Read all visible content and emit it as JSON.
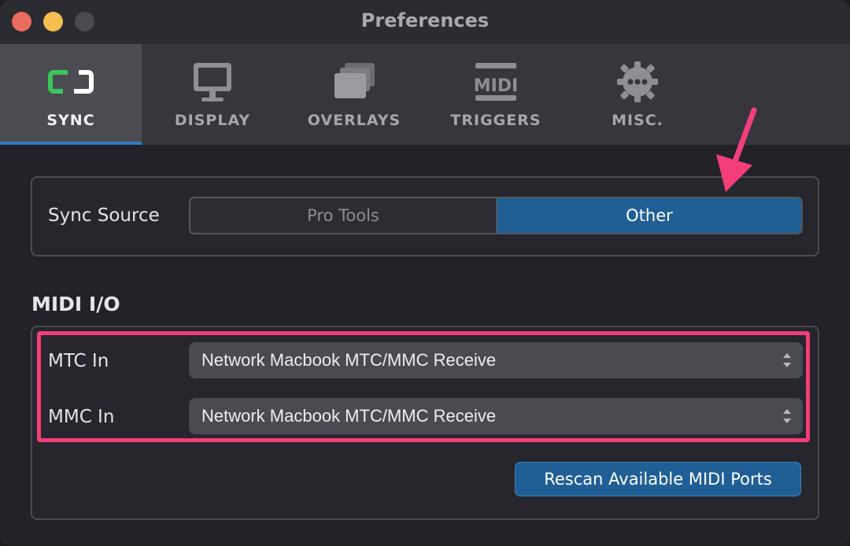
{
  "window": {
    "title": "Preferences"
  },
  "tabs": [
    {
      "label": "SYNC",
      "icon": "sync-icon",
      "active": true
    },
    {
      "label": "DISPLAY",
      "icon": "monitor-icon",
      "active": false
    },
    {
      "label": "OVERLAYS",
      "icon": "overlays-icon",
      "active": false
    },
    {
      "label": "TRIGGERS",
      "icon": "midi-icon",
      "active": false
    },
    {
      "label": "MISC.",
      "icon": "gear-icon",
      "active": false
    }
  ],
  "sync_source": {
    "label": "Sync Source",
    "options": [
      "Pro Tools",
      "Other"
    ],
    "selected": "Other"
  },
  "midi_io": {
    "title": "MIDI I/O",
    "mtc_in": {
      "label": "MTC In",
      "value": "Network Macbook MTC/MMC Receive"
    },
    "mmc_in": {
      "label": "MMC In",
      "value": "Network Macbook MTC/MMC Receive"
    },
    "rescan_label": "Rescan Available MIDI Ports"
  },
  "colors": {
    "accent": "#1f5f95",
    "highlight": "#f43e79",
    "sync_icon_green": "#3cc65a"
  }
}
